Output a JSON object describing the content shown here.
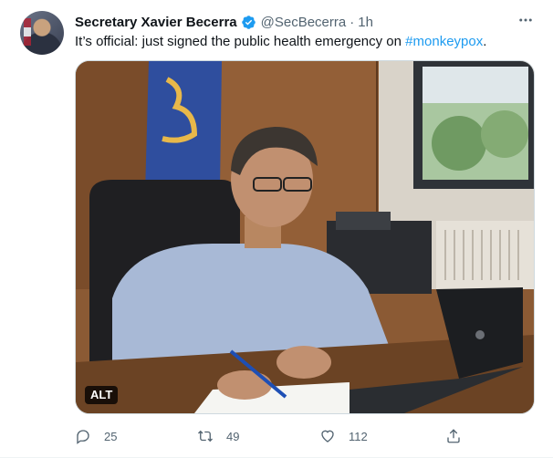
{
  "tweet": {
    "author_name": "Secretary Xavier Becerra",
    "handle": "@SecBecerra",
    "separator": "·",
    "timestamp": "1h",
    "text_before": "It’s official: just signed the public health emergency on ",
    "hashtag": "#monkeypox",
    "text_after": ".",
    "media_alt_badge": "ALT",
    "verified": true,
    "more_icon": "more-horizontal-icon"
  },
  "actions": {
    "replies": "25",
    "retweets": "49",
    "likes": "112",
    "reply_icon": "reply-icon",
    "retweet_icon": "retweet-icon",
    "like_icon": "heart-icon",
    "share_icon": "share-icon"
  },
  "colors": {
    "link": "#1d9bf0",
    "secondary_text": "#536471",
    "primary_text": "#0f1419",
    "border": "#cfd9de"
  }
}
